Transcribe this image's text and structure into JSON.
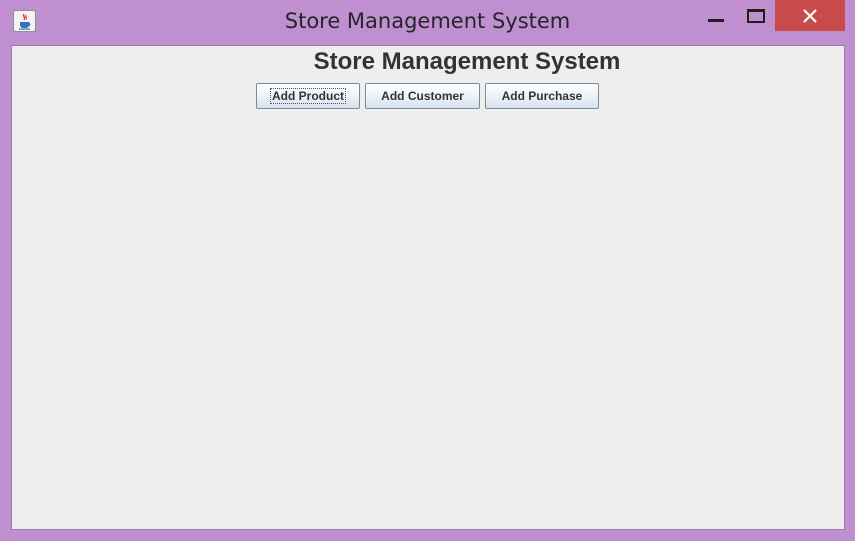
{
  "window": {
    "title": "Store Management System",
    "icon": "java-cup-icon",
    "controls": {
      "minimize": "minimize-icon",
      "maximize": "maximize-icon",
      "close": "close-icon"
    },
    "colors": {
      "frame": "#bf8fcf",
      "close_button": "#c84b4b",
      "content_background": "#eeeeee"
    }
  },
  "main": {
    "heading": "Store Management System",
    "buttons": [
      {
        "label": "Add Product",
        "focused": true
      },
      {
        "label": "Add Customer",
        "focused": false
      },
      {
        "label": "Add Purchase",
        "focused": false
      }
    ]
  }
}
